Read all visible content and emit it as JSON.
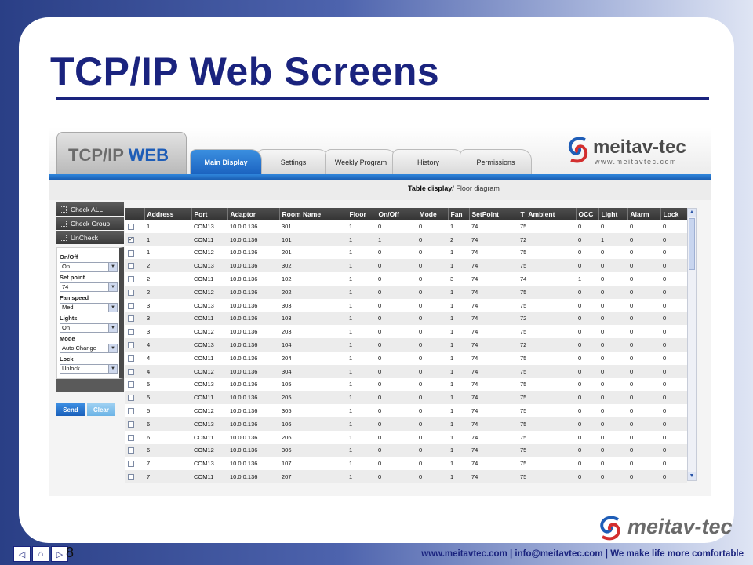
{
  "slide": {
    "title": "TCP/IP Web Screens",
    "page_number": "8",
    "footer_text": "www.meitavtec.com | info@meitavtec.com | We make life more comfortable",
    "footer_logo": "meitav-tec"
  },
  "app": {
    "brand_tcp": "TCP/IP",
    "brand_web": "WEB",
    "tabs": [
      "Main Display",
      "Settings",
      "Weekly Program",
      "History",
      "Permissions"
    ],
    "active_tab": "Main Display",
    "logo_text": "meitav-tec",
    "logo_url": "www.meitavtec.com",
    "subnav": {
      "table": "Table display",
      "sep": "/",
      "floor": "Floor diagram"
    }
  },
  "panel": {
    "buttons": [
      "Check ALL",
      "Check Group",
      "UnCheck"
    ],
    "fields": [
      {
        "label": "On/Off",
        "value": "On"
      },
      {
        "label": "Set point",
        "value": "74"
      },
      {
        "label": "Fan speed",
        "value": "Med"
      },
      {
        "label": "Lights",
        "value": "On"
      },
      {
        "label": "Mode",
        "value": "Auto Change"
      },
      {
        "label": "Lock",
        "value": "Unlock"
      }
    ],
    "send_label": "Send",
    "clear_label": "Clear"
  },
  "table": {
    "columns": [
      "Address",
      "Port",
      "Adaptor",
      "Room Name",
      "Floor",
      "On/Off",
      "Mode",
      "Fan",
      "SetPoint",
      "T_Ambient",
      "OCC",
      "Light",
      "Alarm",
      "Lock"
    ],
    "rows": [
      {
        "checked": false,
        "cells": [
          "1",
          "COM13",
          "10.0.0.136",
          "301",
          "1",
          "0",
          "0",
          "1",
          "74",
          "75",
          "0",
          "0",
          "0",
          "0"
        ]
      },
      {
        "checked": true,
        "cells": [
          "1",
          "COM11",
          "10.0.0.136",
          "101",
          "1",
          "1",
          "0",
          "2",
          "74",
          "72",
          "0",
          "1",
          "0",
          "0"
        ]
      },
      {
        "checked": false,
        "cells": [
          "1",
          "COM12",
          "10.0.0.136",
          "201",
          "1",
          "0",
          "0",
          "1",
          "74",
          "75",
          "0",
          "0",
          "0",
          "0"
        ]
      },
      {
        "checked": false,
        "cells": [
          "2",
          "COM13",
          "10.0.0.136",
          "302",
          "1",
          "0",
          "0",
          "1",
          "74",
          "75",
          "0",
          "0",
          "0",
          "0"
        ]
      },
      {
        "checked": false,
        "cells": [
          "2",
          "COM11",
          "10.0.0.136",
          "102",
          "1",
          "0",
          "0",
          "3",
          "74",
          "74",
          "1",
          "0",
          "0",
          "0"
        ]
      },
      {
        "checked": false,
        "cells": [
          "2",
          "COM12",
          "10.0.0.136",
          "202",
          "1",
          "0",
          "0",
          "1",
          "74",
          "75",
          "0",
          "0",
          "0",
          "0"
        ]
      },
      {
        "checked": false,
        "cells": [
          "3",
          "COM13",
          "10.0.0.136",
          "303",
          "1",
          "0",
          "0",
          "1",
          "74",
          "75",
          "0",
          "0",
          "0",
          "0"
        ]
      },
      {
        "checked": false,
        "cells": [
          "3",
          "COM11",
          "10.0.0.136",
          "103",
          "1",
          "0",
          "0",
          "1",
          "74",
          "72",
          "0",
          "0",
          "0",
          "0"
        ]
      },
      {
        "checked": false,
        "cells": [
          "3",
          "COM12",
          "10.0.0.136",
          "203",
          "1",
          "0",
          "0",
          "1",
          "74",
          "75",
          "0",
          "0",
          "0",
          "0"
        ]
      },
      {
        "checked": false,
        "cells": [
          "4",
          "COM13",
          "10.0.0.136",
          "104",
          "1",
          "0",
          "0",
          "1",
          "74",
          "72",
          "0",
          "0",
          "0",
          "0"
        ]
      },
      {
        "checked": false,
        "cells": [
          "4",
          "COM11",
          "10.0.0.136",
          "204",
          "1",
          "0",
          "0",
          "1",
          "74",
          "75",
          "0",
          "0",
          "0",
          "0"
        ]
      },
      {
        "checked": false,
        "cells": [
          "4",
          "COM12",
          "10.0.0.136",
          "304",
          "1",
          "0",
          "0",
          "1",
          "74",
          "75",
          "0",
          "0",
          "0",
          "0"
        ]
      },
      {
        "checked": false,
        "cells": [
          "5",
          "COM13",
          "10.0.0.136",
          "105",
          "1",
          "0",
          "0",
          "1",
          "74",
          "75",
          "0",
          "0",
          "0",
          "0"
        ]
      },
      {
        "checked": false,
        "cells": [
          "5",
          "COM11",
          "10.0.0.136",
          "205",
          "1",
          "0",
          "0",
          "1",
          "74",
          "75",
          "0",
          "0",
          "0",
          "0"
        ]
      },
      {
        "checked": false,
        "cells": [
          "5",
          "COM12",
          "10.0.0.136",
          "305",
          "1",
          "0",
          "0",
          "1",
          "74",
          "75",
          "0",
          "0",
          "0",
          "0"
        ]
      },
      {
        "checked": false,
        "cells": [
          "6",
          "COM13",
          "10.0.0.136",
          "106",
          "1",
          "0",
          "0",
          "1",
          "74",
          "75",
          "0",
          "0",
          "0",
          "0"
        ]
      },
      {
        "checked": false,
        "cells": [
          "6",
          "COM11",
          "10.0.0.136",
          "206",
          "1",
          "0",
          "0",
          "1",
          "74",
          "75",
          "0",
          "0",
          "0",
          "0"
        ]
      },
      {
        "checked": false,
        "cells": [
          "6",
          "COM12",
          "10.0.0.136",
          "306",
          "1",
          "0",
          "0",
          "1",
          "74",
          "75",
          "0",
          "0",
          "0",
          "0"
        ]
      },
      {
        "checked": false,
        "cells": [
          "7",
          "COM13",
          "10.0.0.136",
          "107",
          "1",
          "0",
          "0",
          "1",
          "74",
          "75",
          "0",
          "0",
          "0",
          "0"
        ]
      },
      {
        "checked": false,
        "cells": [
          "7",
          "COM11",
          "10.0.0.136",
          "207",
          "1",
          "0",
          "0",
          "1",
          "74",
          "75",
          "0",
          "0",
          "0",
          "0"
        ]
      }
    ]
  },
  "colors": {
    "title": "#1a237e",
    "accent": "#1e5db7",
    "header_dark": "#3b3b3b"
  }
}
